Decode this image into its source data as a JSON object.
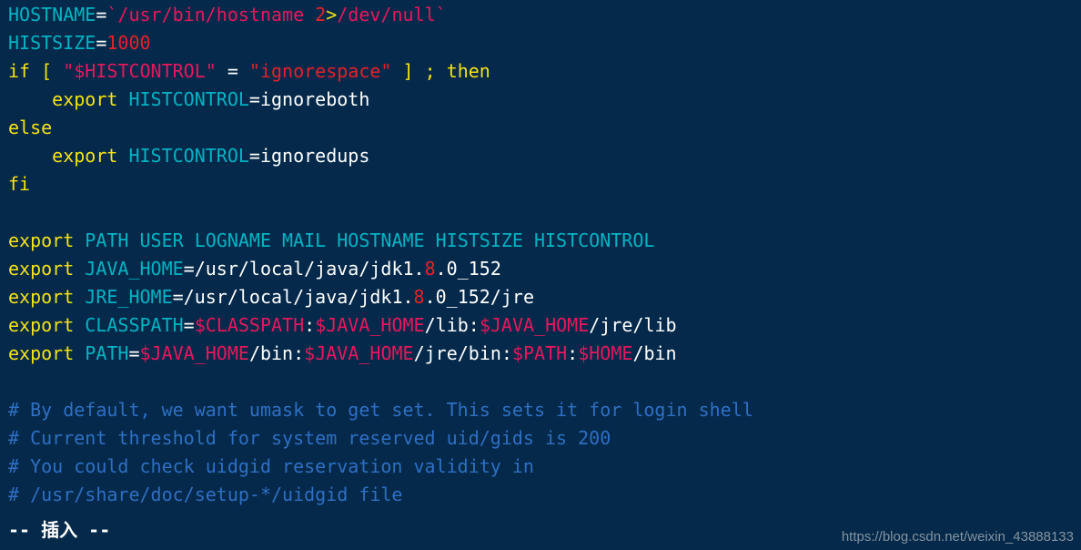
{
  "terminal": {
    "background_color": "#04294a",
    "editor_mode_status": "-- 插入 --",
    "watermark": "https://blog.csdn.net/weixin_43888133",
    "palette": {
      "variable_cyan": "#00b4c4",
      "keyword_yellow": "#f5e215",
      "plain_white": "#ffffff",
      "string_red": "#e8202a",
      "dollar_magenta": "#e8175d",
      "comment_blue": "#2f6fc4",
      "background_navy": "#04294a"
    },
    "lines": [
      {
        "index": 1,
        "text": "HOSTNAME=`/usr/bin/hostname 2>/dev/null`",
        "tokens": [
          {
            "t": "HOSTNAME",
            "c": "tok-var"
          },
          {
            "t": "=",
            "c": "tok-plain"
          },
          {
            "t": "`/usr/bin/hostname ",
            "c": "tok-dollar"
          },
          {
            "t": "2",
            "c": "tok-num"
          },
          {
            "t": ">",
            "c": "tok-redir"
          },
          {
            "t": "/dev/null`",
            "c": "tok-dollar"
          }
        ]
      },
      {
        "index": 2,
        "text": "HISTSIZE=1000",
        "tokens": [
          {
            "t": "HISTSIZE",
            "c": "tok-var"
          },
          {
            "t": "=",
            "c": "tok-plain"
          },
          {
            "t": "1000",
            "c": "tok-num"
          }
        ]
      },
      {
        "index": 3,
        "text": "if [ \"$HISTCONTROL\" = \"ignorespace\" ] ; then",
        "tokens": [
          {
            "t": "if ",
            "c": "tok-kw"
          },
          {
            "t": "[ ",
            "c": "tok-kw"
          },
          {
            "t": "\"$HISTCONTROL\"",
            "c": "tok-dollar"
          },
          {
            "t": " = ",
            "c": "tok-plain"
          },
          {
            "t": "\"ignorespace\"",
            "c": "tok-str"
          },
          {
            "t": " ]",
            "c": "tok-kw"
          },
          {
            "t": " ; ",
            "c": "tok-kw"
          },
          {
            "t": "then",
            "c": "tok-kw"
          }
        ]
      },
      {
        "index": 4,
        "text": "    export HISTCONTROL=ignoreboth",
        "tokens": [
          {
            "t": "    ",
            "c": "tok-plain"
          },
          {
            "t": "export",
            "c": "tok-kw"
          },
          {
            "t": " ",
            "c": "tok-plain"
          },
          {
            "t": "HISTCONTROL",
            "c": "tok-var"
          },
          {
            "t": "=ignoreboth",
            "c": "tok-plain"
          }
        ]
      },
      {
        "index": 5,
        "text": "else",
        "tokens": [
          {
            "t": "else",
            "c": "tok-kw"
          }
        ]
      },
      {
        "index": 6,
        "text": "    export HISTCONTROL=ignoredups",
        "tokens": [
          {
            "t": "    ",
            "c": "tok-plain"
          },
          {
            "t": "export",
            "c": "tok-kw"
          },
          {
            "t": " ",
            "c": "tok-plain"
          },
          {
            "t": "HISTCONTROL",
            "c": "tok-var"
          },
          {
            "t": "=ignoredups",
            "c": "tok-plain"
          }
        ]
      },
      {
        "index": 7,
        "text": "fi",
        "tokens": [
          {
            "t": "fi",
            "c": "tok-kw"
          }
        ]
      },
      {
        "index": 8,
        "text": "",
        "tokens": []
      },
      {
        "index": 9,
        "text": "export PATH USER LOGNAME MAIL HOSTNAME HISTSIZE HISTCONTROL",
        "tokens": [
          {
            "t": "export",
            "c": "tok-kw"
          },
          {
            "t": " ",
            "c": "tok-plain"
          },
          {
            "t": "PATH USER LOGNAME MAIL HOSTNAME HISTSIZE HISTCONTROL",
            "c": "tok-var"
          }
        ]
      },
      {
        "index": 10,
        "text": "export JAVA_HOME=/usr/local/java/jdk1.8.0_152",
        "tokens": [
          {
            "t": "export",
            "c": "tok-kw"
          },
          {
            "t": " ",
            "c": "tok-plain"
          },
          {
            "t": "JAVA_HOME",
            "c": "tok-var"
          },
          {
            "t": "=/usr/local/java/jdk1.",
            "c": "tok-plain"
          },
          {
            "t": "8",
            "c": "tok-num"
          },
          {
            "t": ".0_152",
            "c": "tok-plain"
          }
        ]
      },
      {
        "index": 11,
        "text": "export JRE_HOME=/usr/local/java/jdk1.8.0_152/jre",
        "tokens": [
          {
            "t": "export",
            "c": "tok-kw"
          },
          {
            "t": " ",
            "c": "tok-plain"
          },
          {
            "t": "JRE_HOME",
            "c": "tok-var"
          },
          {
            "t": "=/usr/local/java/jdk1.",
            "c": "tok-plain"
          },
          {
            "t": "8",
            "c": "tok-num"
          },
          {
            "t": ".0_152/jre",
            "c": "tok-plain"
          }
        ]
      },
      {
        "index": 12,
        "text": "export CLASSPATH=$CLASSPATH:$JAVA_HOME/lib:$JAVA_HOME/jre/lib",
        "tokens": [
          {
            "t": "export",
            "c": "tok-kw"
          },
          {
            "t": " ",
            "c": "tok-plain"
          },
          {
            "t": "CLASSPATH",
            "c": "tok-var"
          },
          {
            "t": "=",
            "c": "tok-plain"
          },
          {
            "t": "$CLASSPATH",
            "c": "tok-dollar"
          },
          {
            "t": ":",
            "c": "tok-plain"
          },
          {
            "t": "$JAVA_HOME",
            "c": "tok-dollar"
          },
          {
            "t": "/lib:",
            "c": "tok-plain"
          },
          {
            "t": "$JAVA_HOME",
            "c": "tok-dollar"
          },
          {
            "t": "/jre/lib",
            "c": "tok-plain"
          }
        ]
      },
      {
        "index": 13,
        "text": "export PATH=$JAVA_HOME/bin:$JAVA_HOME/jre/bin:$PATH:$HOME/bin",
        "tokens": [
          {
            "t": "export",
            "c": "tok-kw"
          },
          {
            "t": " ",
            "c": "tok-plain"
          },
          {
            "t": "PATH",
            "c": "tok-var"
          },
          {
            "t": "=",
            "c": "tok-plain"
          },
          {
            "t": "$JAVA_HOME",
            "c": "tok-dollar"
          },
          {
            "t": "/bin:",
            "c": "tok-plain"
          },
          {
            "t": "$JAVA_HOME",
            "c": "tok-dollar"
          },
          {
            "t": "/jre/bin:",
            "c": "tok-plain"
          },
          {
            "t": "$PATH",
            "c": "tok-dollar"
          },
          {
            "t": ":",
            "c": "tok-plain"
          },
          {
            "t": "$HOME",
            "c": "tok-dollar"
          },
          {
            "t": "/bin",
            "c": "tok-plain"
          }
        ]
      },
      {
        "index": 14,
        "text": "",
        "tokens": []
      },
      {
        "index": 15,
        "text": "# By default, we want umask to get set. This sets it for login shell",
        "tokens": [
          {
            "t": "# By default, we want umask to get set. This sets it for login shell",
            "c": "tok-comment"
          }
        ]
      },
      {
        "index": 16,
        "text": "# Current threshold for system reserved uid/gids is 200",
        "tokens": [
          {
            "t": "# Current threshold for system reserved uid/gids is 200",
            "c": "tok-comment"
          }
        ]
      },
      {
        "index": 17,
        "text": "# You could check uidgid reservation validity in",
        "tokens": [
          {
            "t": "# You could check uidgid reservation validity in",
            "c": "tok-comment"
          }
        ]
      },
      {
        "index": 18,
        "text": "# /usr/share/doc/setup-*/uidgid file",
        "tokens": [
          {
            "t": "# /usr/share/doc/setup-*/uidgid file",
            "c": "tok-comment"
          }
        ]
      }
    ]
  }
}
